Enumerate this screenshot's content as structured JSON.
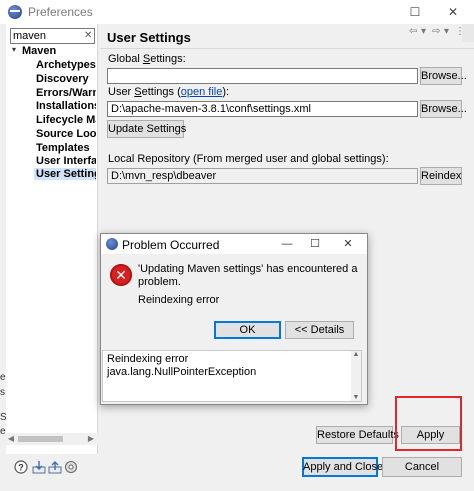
{
  "window": {
    "title": "Preferences",
    "buttons": {
      "minimize": "—",
      "maximize": "☐",
      "close": "✕"
    }
  },
  "filter": {
    "value": "maven",
    "clear": "✕"
  },
  "tree": {
    "root": "Maven",
    "items": [
      "Archetypes",
      "Discovery",
      "Errors/Warn",
      "Installations",
      "Lifecycle Map",
      "Source Look",
      "Templates",
      "User Interfac",
      "User Settings"
    ],
    "selected_index": 8
  },
  "page": {
    "title": "User Settings",
    "nav": {
      "back": "⇦",
      "back_menu": "▾",
      "forward": "⇨",
      "forward_menu": "▾",
      "view_menu": "⋮"
    },
    "global_label_pre": "Global ",
    "global_label_mn": "S",
    "global_label_post": "ettings:",
    "global_value": "",
    "browse1": "Browse...",
    "user_label_pre": "User ",
    "user_label_mn": "S",
    "user_label_mid": "ettings (",
    "user_label_link": "open file",
    "user_label_post": "):",
    "user_value": "D:\\apache-maven-3.8.1\\conf\\settings.xml",
    "browse2": "Browse...",
    "update_button": "Update Settings",
    "repo_label": "Local Repository (From merged user and global settings):",
    "repo_value": "D:\\mvn_resp\\dbeaver",
    "reindex": "Reindex",
    "restore_defaults": "Restore Defaults",
    "apply": "Apply",
    "apply_and_close": "Apply and Close",
    "cancel": "Cancel"
  },
  "dialog": {
    "title": "Problem Occurred",
    "buttons": {
      "minimize": "—",
      "maximize": "☐",
      "close": "✕"
    },
    "error_glyph": "✕",
    "message_line1": "'Updating Maven settings' has encountered a",
    "message_line2": "problem.",
    "detail": "Reindexing error",
    "ok": "OK",
    "details_button": "<< Details",
    "details_text_line1": "Reindexing error",
    "details_text_line2": "java.lang.NullPointerException"
  },
  "edge_fragments": [
    "e",
    "s",
    "S",
    "e"
  ],
  "colors": {
    "highlight": "#e0272a",
    "selection": "#cfe3fb",
    "link": "#0645ad",
    "error": "#d92020"
  }
}
